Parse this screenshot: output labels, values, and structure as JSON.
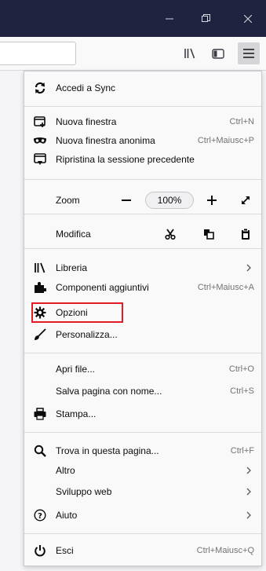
{
  "window": {
    "minimize_icon": "minimize-icon",
    "restore_icon": "restore-icon",
    "close_icon": "close-icon"
  },
  "toolbar": {
    "library_icon": "library-icon",
    "sidebar_icon": "sidebar-icon",
    "menu_icon": "hamburger-menu-icon"
  },
  "menu": {
    "sync": {
      "label": "Accedi a Sync",
      "icon": "sync-icon"
    },
    "new_window": {
      "label": "Nuova finestra",
      "shortcut": "Ctrl+N",
      "icon": "new-window-icon"
    },
    "private_window": {
      "label": "Nuova finestra anonima",
      "shortcut": "Ctrl+Maiusc+P",
      "icon": "private-mask-icon"
    },
    "restore_session": {
      "label": "Ripristina la sessione precedente",
      "icon": "restore-session-icon"
    },
    "zoom": {
      "label": "Zoom",
      "value": "100%"
    },
    "edit": {
      "label": "Modifica"
    },
    "library": {
      "label": "Libreria",
      "icon": "library-icon"
    },
    "addons": {
      "label": "Componenti aggiuntivi",
      "shortcut": "Ctrl+Maiusc+A",
      "icon": "puzzle-icon"
    },
    "options": {
      "label": "Opzioni",
      "icon": "gear-icon"
    },
    "customize": {
      "label": "Personalizza...",
      "icon": "paintbrush-icon"
    },
    "open_file": {
      "label": "Apri file...",
      "shortcut": "Ctrl+O"
    },
    "save_page": {
      "label": "Salva pagina con nome...",
      "shortcut": "Ctrl+S"
    },
    "print": {
      "label": "Stampa...",
      "icon": "printer-icon"
    },
    "find": {
      "label": "Trova in questa pagina...",
      "shortcut": "Ctrl+F",
      "icon": "search-icon"
    },
    "more": {
      "label": "Altro"
    },
    "web_dev": {
      "label": "Sviluppo web"
    },
    "help": {
      "label": "Aiuto",
      "icon": "help-icon"
    },
    "quit": {
      "label": "Esci",
      "shortcut": "Ctrl+Maiusc+Q",
      "icon": "power-icon"
    }
  },
  "colors": {
    "titlebar": "#202340",
    "highlight": "#e01b24"
  }
}
